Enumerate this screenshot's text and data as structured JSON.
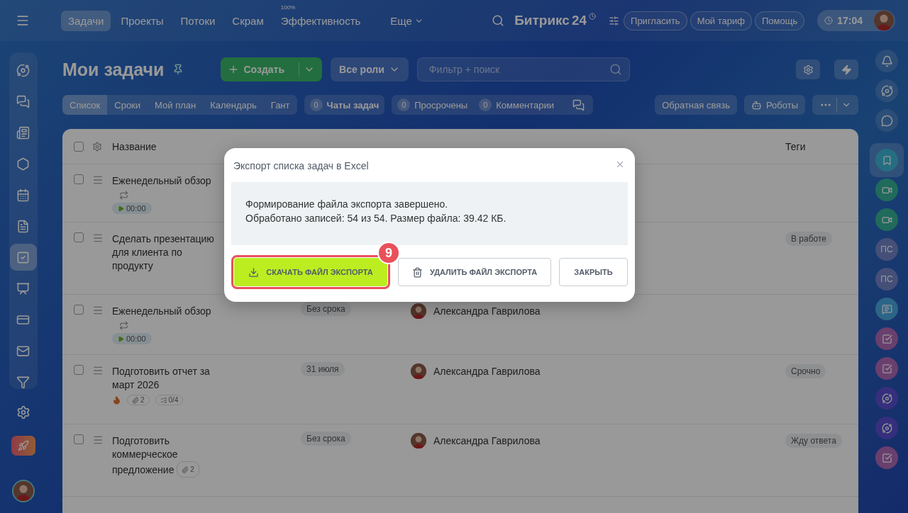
{
  "top_bar": {
    "tabs": [
      {
        "label": "Задачи",
        "selected": true
      },
      {
        "label": "Проекты",
        "selected": false
      },
      {
        "label": "Потоки",
        "selected": false
      },
      {
        "label": "Скрам",
        "selected": false
      },
      {
        "label": "Эффективность",
        "selected": false,
        "superscript": "100%"
      },
      {
        "label": "Еще",
        "selected": false,
        "kind": "dropdown"
      }
    ],
    "logo": {
      "name": "Битрикс",
      "number": "24"
    },
    "buttons": [
      "Пригласить",
      "Мой тариф",
      "Помощь"
    ],
    "clock": "17:04"
  },
  "left_sidebar": {
    "items": [
      {
        "kind": "feed",
        "selected": false
      },
      {
        "kind": "chat",
        "selected": false
      },
      {
        "kind": "news",
        "selected": false
      },
      {
        "kind": "groups",
        "selected": false
      },
      {
        "kind": "calendar",
        "selected": false
      },
      {
        "kind": "docs",
        "selected": false
      },
      {
        "kind": "tasks",
        "selected": true
      },
      {
        "kind": "boards",
        "selected": false
      },
      {
        "kind": "payments",
        "selected": false
      },
      {
        "kind": "mail",
        "selected": false
      },
      {
        "kind": "funnel",
        "selected": false
      }
    ]
  },
  "page": {
    "title": "Мои задачи",
    "create_button": "Создать",
    "roles_button": "Все роли",
    "filter": {
      "placeholder": "Фильтр + поиск"
    },
    "view_tabs": [
      {
        "label": "Список",
        "selected": true
      },
      {
        "label": "Сроки",
        "selected": false
      },
      {
        "label": "Мой план",
        "selected": false
      },
      {
        "label": "Календарь",
        "selected": false
      },
      {
        "label": "Гант",
        "selected": false
      }
    ],
    "counters": [
      {
        "count": "0",
        "label": "Чаты задач"
      },
      {
        "count": "0",
        "label": "Просрочены"
      },
      {
        "count": "0",
        "label": "Комментарии"
      }
    ],
    "feedback_button": "Обратная связь",
    "robots_button": "Роботы"
  },
  "table": {
    "select_all_checked": false,
    "columns": [
      {
        "label": "Название"
      },
      {
        "label": "Теги"
      }
    ],
    "rows": [
      {
        "checked": false,
        "title": "Еженедельный обзор",
        "recurring": true,
        "timer": "00:00"
      },
      {
        "checked": false,
        "title": "Сделать презентацию для клиента по продукту",
        "tag": "В работе"
      },
      {
        "checked": false,
        "title": "Еженедельный обзор",
        "recurring": true,
        "timer": "00:00",
        "deadline": "Без срока",
        "assignee": "Александра Гаврилова"
      },
      {
        "checked": false,
        "title": "Подготовить отчет за март 2026",
        "urgent": true,
        "attachments": "2",
        "checklist": "0/4",
        "deadline": "31 июля",
        "assignee": "Александра Гаврилова",
        "tag": "Срочно"
      },
      {
        "checked": false,
        "title": "Подготовить коммерческое предложение",
        "attachments": "2",
        "deadline": "Без срока",
        "assignee": "Александра Гаврилова",
        "tag": "Жду ответа"
      }
    ]
  },
  "right_sidebar": {
    "items": [
      {
        "kind": "bookmark",
        "selected": true
      },
      {
        "kind": "video",
        "selected": false
      },
      {
        "kind": "video",
        "selected": false
      },
      {
        "kind": "initials",
        "text": "ПС",
        "selected": false
      },
      {
        "kind": "initials",
        "text": "ПС",
        "selected": false
      },
      {
        "kind": "chat",
        "selected": false
      },
      {
        "kind": "task",
        "selected": false
      },
      {
        "kind": "task",
        "selected": false
      },
      {
        "kind": "copilot",
        "selected": false
      },
      {
        "kind": "copilot",
        "selected": false
      },
      {
        "kind": "task",
        "selected": false
      }
    ]
  },
  "dialog": {
    "title": "Экспорт списка задач в Excel",
    "message": [
      "Формирование файла экспорта завершено.",
      "Обработано записей: 54 из 54. Размер файла: 39.42 КБ."
    ],
    "buttons": [
      {
        "kind": "download",
        "label": "СКАЧАТЬ ФАЙЛ ЭКСПОРТА"
      },
      {
        "kind": "delete",
        "label": "УДАЛИТЬ ФАЙЛ ЭКСПОРТА"
      },
      {
        "kind": "close",
        "label": "ЗАКРЫТЬ"
      }
    ],
    "step_badge": "9"
  }
}
